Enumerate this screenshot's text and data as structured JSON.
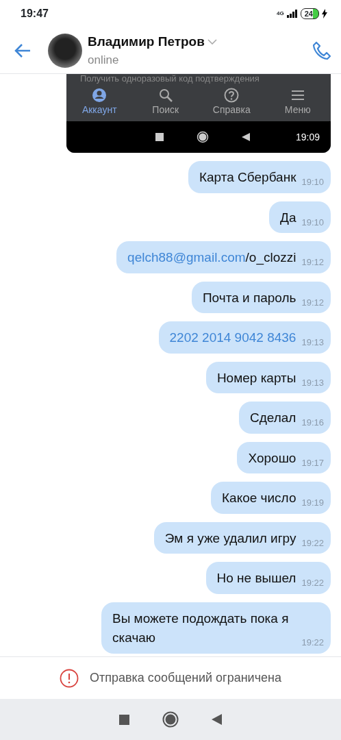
{
  "status_bar": {
    "time": "19:47",
    "network": "4G",
    "battery": "24"
  },
  "header": {
    "name": "Владимир Петров",
    "status": "online"
  },
  "attachment": {
    "cut_text": "Получить одноразовый код подтверждения",
    "tabs": [
      {
        "label": "Аккаунт",
        "selected": true,
        "kind": "account"
      },
      {
        "label": "Поиск",
        "selected": false,
        "kind": "search"
      },
      {
        "label": "Справка",
        "selected": false,
        "kind": "help"
      },
      {
        "label": "Меню",
        "selected": false,
        "kind": "menu"
      }
    ],
    "time": "19:09"
  },
  "messages": [
    {
      "parts": [
        {
          "text": "Карта Сбербанк",
          "link": false
        }
      ],
      "time": "19:10"
    },
    {
      "parts": [
        {
          "text": "Да",
          "link": false
        }
      ],
      "time": "19:10"
    },
    {
      "parts": [
        {
          "text": "qelch88@gmail.com",
          "link": true
        },
        {
          "text": "/o_clozzi",
          "link": false
        }
      ],
      "time": "19:12"
    },
    {
      "parts": [
        {
          "text": "Почта и пароль",
          "link": false
        }
      ],
      "time": "19:12"
    },
    {
      "parts": [
        {
          "text": "2202 2014 9042 8436",
          "link": true
        }
      ],
      "time": "19:13"
    },
    {
      "parts": [
        {
          "text": "Номер карты",
          "link": false
        }
      ],
      "time": "19:13"
    },
    {
      "parts": [
        {
          "text": "Сделал",
          "link": false
        }
      ],
      "time": "19:16"
    },
    {
      "parts": [
        {
          "text": "Хорошо",
          "link": false
        }
      ],
      "time": "19:17"
    },
    {
      "parts": [
        {
          "text": "Какое число",
          "link": false
        }
      ],
      "time": "19:19"
    },
    {
      "parts": [
        {
          "text": "Эм я уже удалил игру",
          "link": false
        }
      ],
      "time": "19:22"
    },
    {
      "parts": [
        {
          "text": "Но не вышел",
          "link": false
        }
      ],
      "time": "19:22"
    },
    {
      "parts": [
        {
          "text": "Вы можете подождать пока я скачаю",
          "link": false
        }
      ],
      "time": "19:22"
    }
  ],
  "restriction": {
    "text": "Отправка сообщений ограничена"
  }
}
